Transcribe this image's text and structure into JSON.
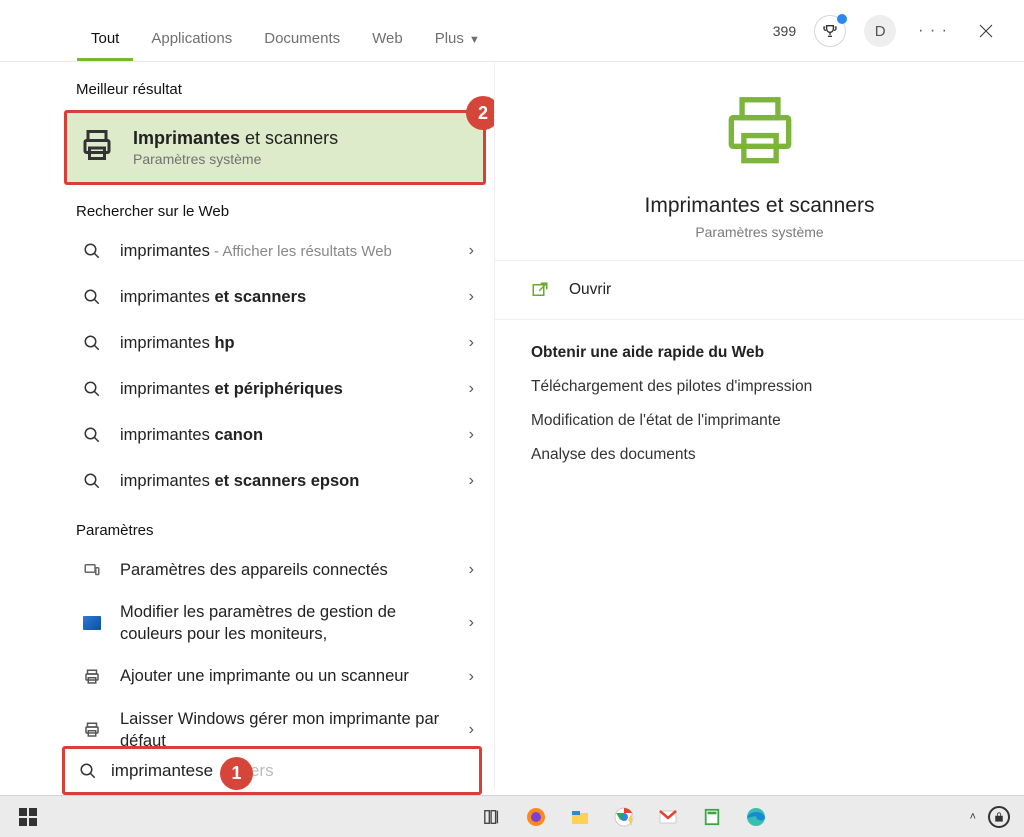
{
  "topbar": {
    "tabs": [
      "Tout",
      "Applications",
      "Documents",
      "Web",
      "Plus"
    ],
    "active_tab": "Tout",
    "points": "399",
    "avatar_initial": "D"
  },
  "sections": {
    "best": "Meilleur résultat",
    "web": "Rechercher sur le Web",
    "settings": "Paramètres"
  },
  "best_result": {
    "title_bold": "Imprimantes",
    "title_rest": " et scanners",
    "subtitle": "Paramètres système",
    "badge": "2"
  },
  "web_results": [
    {
      "prefix": "imprimantes",
      "bold": "",
      "hint": " - Afficher les résultats Web"
    },
    {
      "prefix": "imprimantes ",
      "bold": "et scanners",
      "hint": ""
    },
    {
      "prefix": "imprimantes ",
      "bold": "hp",
      "hint": ""
    },
    {
      "prefix": "imprimantes ",
      "bold": "et périphériques",
      "hint": ""
    },
    {
      "prefix": "imprimantes ",
      "bold": "canon",
      "hint": ""
    },
    {
      "prefix": "imprimantes ",
      "bold": "et scanners epson",
      "hint": ""
    }
  ],
  "settings_results": [
    {
      "icon": "devices",
      "text": "Paramètres des appareils connectés"
    },
    {
      "icon": "monitor",
      "text": "Modifier les paramètres de gestion de couleurs pour les moniteurs,"
    },
    {
      "icon": "printer",
      "text": "Ajouter une imprimante ou un scanneur"
    },
    {
      "icon": "printer",
      "text": "Laisser Windows gérer mon imprimante par défaut"
    }
  ],
  "preview": {
    "title": "Imprimantes et scanners",
    "subtitle": "Paramètres système",
    "open": "Ouvrir",
    "help_title": "Obtenir une aide rapide du Web",
    "help_links": [
      "Téléchargement des pilotes d'impression",
      "Modification de l'état de l'imprimante",
      "Analyse des documents"
    ]
  },
  "search": {
    "typed": "imprimantes",
    "completion_prefix": " e",
    "completion_rest": "nners",
    "badge": "1"
  }
}
